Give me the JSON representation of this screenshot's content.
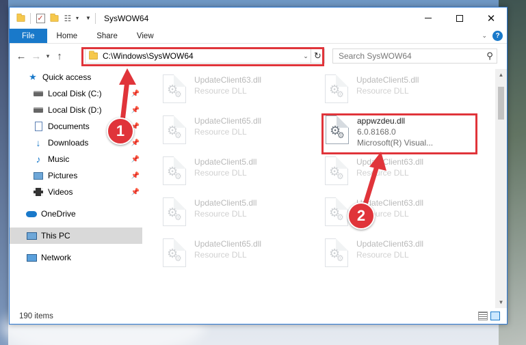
{
  "window": {
    "title": "SysWOW64",
    "controls": {
      "minimize": "",
      "maximize": "",
      "close": "✕"
    }
  },
  "ribbon": {
    "tabs": [
      "File",
      "Home",
      "Share",
      "View"
    ]
  },
  "address": {
    "path": "C:\\Windows\\SysWOW64",
    "search_placeholder": "Search SysWOW64"
  },
  "nav": {
    "quick_access": "Quick access",
    "items": [
      {
        "label": "Local Disk (C:)",
        "icon": "disk-icon"
      },
      {
        "label": "Local Disk (D:)",
        "icon": "disk-icon"
      },
      {
        "label": "Documents",
        "icon": "document-icon"
      },
      {
        "label": "Downloads",
        "icon": "download-icon"
      },
      {
        "label": "Music",
        "icon": "music-icon"
      },
      {
        "label": "Pictures",
        "icon": "pictures-icon"
      },
      {
        "label": "Videos",
        "icon": "videos-icon"
      }
    ],
    "onedrive": "OneDrive",
    "this_pc": "This PC",
    "network": "Network"
  },
  "files": [
    {
      "name": "UpdateClient63.dll",
      "sub": "Resource DLL",
      "faded": true
    },
    {
      "name": "UpdateClient5.dll",
      "sub": "Resource DLL",
      "faded": true
    },
    {
      "name": "UpdateClient65.dll",
      "sub": "Resource DLL",
      "faded": true
    },
    {
      "name": "appwzdeu.dll",
      "version": "6.0.8168.0",
      "sub": "Microsoft(R) Visual...",
      "faded": false
    },
    {
      "name": "UpdateClient5.dll",
      "sub": "Resource DLL",
      "faded": true
    },
    {
      "name": "UpdateClient63.dll",
      "sub": "Resource DLL",
      "faded": true
    },
    {
      "name": "UpdateClient5.dll",
      "sub": "Resource DLL",
      "faded": true
    },
    {
      "name": "UpdateClient63.dll",
      "sub": "Resource DLL",
      "faded": true
    },
    {
      "name": "UpdateClient65.dll",
      "sub": "Resource DLL",
      "faded": true
    },
    {
      "name": "UpdateClient63.dll",
      "sub": "Resource DLL",
      "faded": true
    }
  ],
  "status": {
    "count": "190 items"
  },
  "annotations": {
    "step1": "1",
    "step2": "2",
    "color": "#e0343a"
  }
}
